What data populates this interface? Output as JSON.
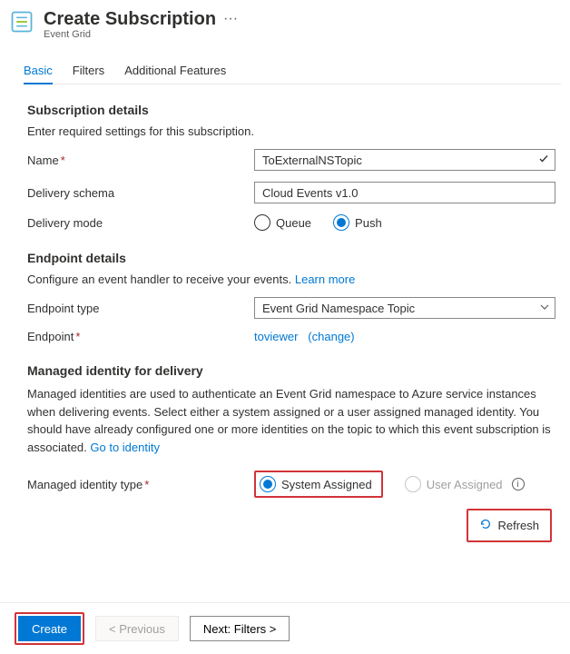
{
  "header": {
    "title": "Create Subscription",
    "subtitle": "Event Grid"
  },
  "tabs": {
    "basic": "Basic",
    "filters": "Filters",
    "additional": "Additional Features"
  },
  "subscription_details": {
    "heading": "Subscription details",
    "description": "Enter required settings for this subscription.",
    "name_label": "Name",
    "name_value": "ToExternalNSTopic",
    "delivery_schema_label": "Delivery schema",
    "delivery_schema_value": "Cloud Events v1.0",
    "delivery_mode_label": "Delivery mode",
    "delivery_mode_options": {
      "queue": "Queue",
      "push": "Push"
    }
  },
  "endpoint_details": {
    "heading": "Endpoint details",
    "description": "Configure an event handler to receive your events.",
    "learn_more": "Learn more",
    "type_label": "Endpoint type",
    "type_value": "Event Grid Namespace Topic",
    "endpoint_label": "Endpoint",
    "endpoint_value": "toviewer",
    "change": "(change)"
  },
  "managed_identity": {
    "heading": "Managed identity for delivery",
    "body": "Managed identities are used to authenticate an Event Grid namespace to Azure service instances when delivering events. Select either a system assigned or a user assigned managed identity. You should have already configured one or more identities on the topic to which this event subscription is associated.",
    "go_to_identity": "Go to identity",
    "type_label": "Managed identity type",
    "system_assigned": "System Assigned",
    "user_assigned": "User Assigned",
    "refresh": "Refresh"
  },
  "footer": {
    "create": "Create",
    "previous": "<  Previous",
    "next": "Next: Filters  >"
  }
}
